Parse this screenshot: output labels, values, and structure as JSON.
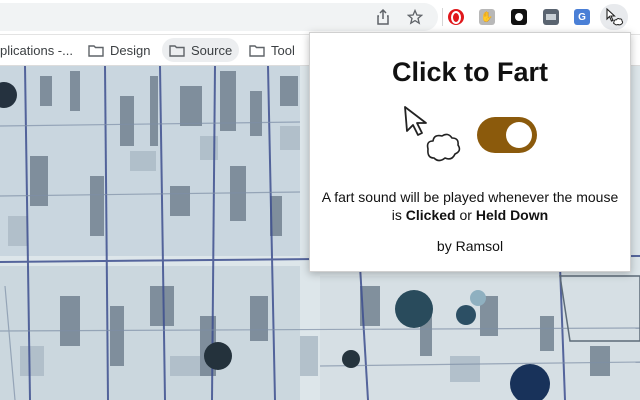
{
  "bookmarks": [
    {
      "label": "plications -..."
    },
    {
      "label": "Design"
    },
    {
      "label": "Source"
    },
    {
      "label": "Tool"
    }
  ],
  "popup": {
    "title": "Click to Fart",
    "toggle_on": true,
    "desc_part1": "A fart sound will be played whenever the mouse is ",
    "desc_clicked": "Clicked",
    "desc_or": " or ",
    "desc_held": "Held Down",
    "by_line": "by Ramsol"
  },
  "colors": {
    "toggle": "#8b5a0c",
    "map_base": "#dfe7ea"
  },
  "icons": [
    "share-icon",
    "star-icon",
    "opera-extension-icon",
    "accessibility-extension-icon",
    "dark-extension-icon",
    "image-extension-icon",
    "translate-extension-icon",
    "click-to-fart-extension-icon",
    "folder-icon",
    "cursor-icon",
    "cloud-icon"
  ]
}
